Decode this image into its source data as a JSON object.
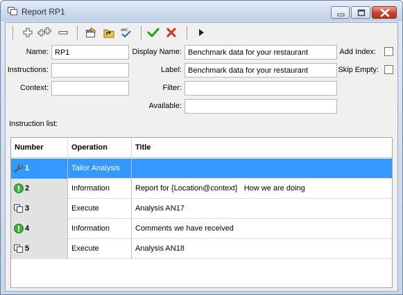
{
  "window": {
    "title": "Report RP1",
    "icon": "report-icon",
    "controls": [
      "minimize-icon",
      "maximize-icon",
      "close-icon"
    ]
  },
  "toolbar": {
    "buttons": [
      {
        "name": "add",
        "icon": "plus-icon"
      },
      {
        "name": "add-child",
        "icon": "double-plus-icon"
      },
      {
        "name": "remove",
        "icon": "minus-icon"
      },
      {
        "name": "properties",
        "icon": "properties-icon"
      },
      {
        "name": "move-up-level",
        "icon": "folder-up-icon"
      },
      {
        "name": "spell-check",
        "icon": "spell-check-icon"
      },
      {
        "name": "accept",
        "icon": "checkmark-icon"
      },
      {
        "name": "cancel",
        "icon": "red-x-icon"
      },
      {
        "name": "run",
        "icon": "play-icon"
      }
    ]
  },
  "form": {
    "name_label": "Name:",
    "name_value": "RP1",
    "instructions_label": "Instructions:",
    "instructions_value": "",
    "context_label": "Context:",
    "context_value": "",
    "display_name_label": "Display Name:",
    "display_name_value": "Benchmark data for your restaurant",
    "label_label": "Label:",
    "label_value": "Benchmark data for your restaurant",
    "filter_label": "Filter:",
    "filter_value": "",
    "available_label": "Available:",
    "available_value": "",
    "add_index_label": "Add Index:",
    "add_index_checked": false,
    "skip_empty_label": "Skip Empty:",
    "skip_empty_checked": false
  },
  "instruction_list": {
    "label": "Instruction list:",
    "columns": [
      "Number",
      "Operation",
      "Title"
    ],
    "rows": [
      {
        "number": "1",
        "operation": "Tailor Analysis",
        "title": "",
        "icon": "wrench-icon",
        "selected": true
      },
      {
        "number": "2",
        "operation": "Information",
        "title": "Report for {Location@context}   How we are doing",
        "icon": "info-exclamation-icon",
        "selected": false
      },
      {
        "number": "3",
        "operation": "Execute",
        "title": "Analysis AN17",
        "icon": "copy-pages-icon",
        "selected": false
      },
      {
        "number": "4",
        "operation": "Information",
        "title": "Comments we have received",
        "icon": "info-exclamation-icon",
        "selected": false
      },
      {
        "number": "5",
        "operation": "Execute",
        "title": "Analysis AN18",
        "icon": "copy-pages-icon",
        "selected": false
      }
    ]
  },
  "colors": {
    "selection": "#3399ff",
    "info_icon": "#3fb33f",
    "accept_green": "#2aa22a",
    "cancel_red": "#d83b2b",
    "close_button": "#c9452e"
  }
}
